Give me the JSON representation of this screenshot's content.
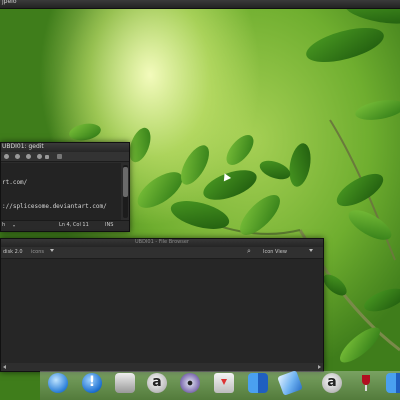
{
  "top_window": {
    "title": "jpelo"
  },
  "gedit": {
    "title": "UBDI01: gedit",
    "lines": [
      "rt.com/",
      "://splicesome.deviantart.com/"
    ],
    "status": {
      "language": "h",
      "position": "Ln 4, Col 11",
      "mode": "INS"
    }
  },
  "file_manager": {
    "title": "UBDI01 - File Browser",
    "location": "disk 2.0",
    "location_extra": "icons",
    "view_mode": "Icon View"
  },
  "dock": {
    "items": [
      {
        "name": "safari-icon",
        "glyph": ""
      },
      {
        "name": "alert-icon",
        "glyph": "!"
      },
      {
        "name": "disk-utility-icon",
        "glyph": ""
      },
      {
        "name": "amazon-icon-1",
        "glyph": "a"
      },
      {
        "name": "dvd-player-icon",
        "glyph": ""
      },
      {
        "name": "downloads-icon",
        "glyph": ""
      },
      {
        "name": "finder-icon",
        "glyph": ""
      },
      {
        "name": "mail-icon",
        "glyph": ""
      },
      {
        "name": "amazon-icon-2",
        "glyph": "a"
      },
      {
        "name": "wine-icon",
        "glyph": ""
      },
      {
        "name": "finder-icon-2",
        "glyph": ""
      }
    ]
  }
}
